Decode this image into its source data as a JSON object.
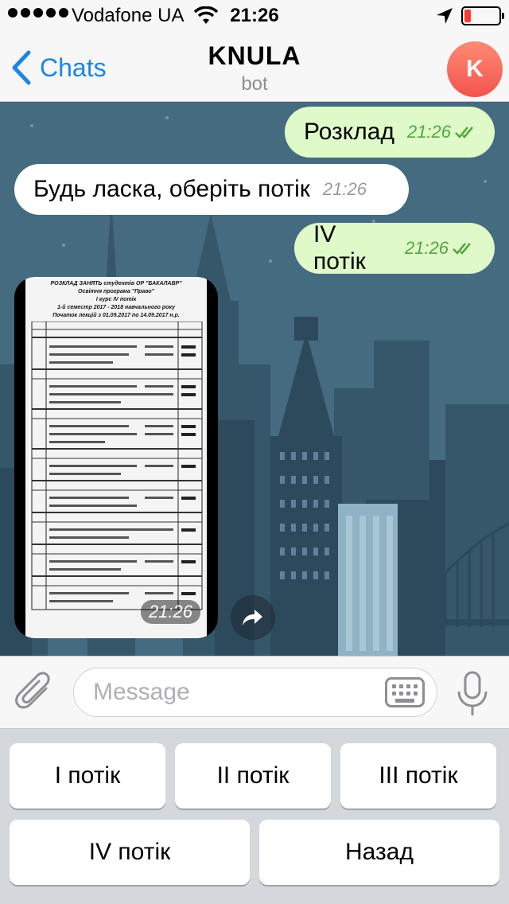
{
  "status_bar": {
    "carrier": "Vodafone UA",
    "time": "21:26",
    "battery_level": 0.1
  },
  "nav": {
    "back_label": "Chats",
    "title": "KNULA",
    "subtitle": "bot",
    "avatar_letter": "K",
    "avatar_color": "#f2544e"
  },
  "messages": [
    {
      "direction": "out",
      "text": "Розклад",
      "time": "21:26",
      "status": "read"
    },
    {
      "direction": "in",
      "text": "Будь ласка, оберіть потік",
      "time": "21:26"
    },
    {
      "direction": "out",
      "text": "IV потік",
      "time": "21:26",
      "status": "read"
    },
    {
      "direction": "in",
      "type": "photo",
      "time": "21:26",
      "doc_title_lines": [
        "РОЗКЛАД ЗАНЯТЬ студентів ОР \"БАКАЛАВР\"",
        "Освітня програма \"Право\"",
        "I курс IV потік",
        "1-й семестр 2017 - 2018 навчального року",
        "Початок лекцій з 01.09.2017 по 14.09.2017 н.р."
      ]
    }
  ],
  "input": {
    "placeholder": "Message"
  },
  "bot_keyboard": {
    "buttons": [
      "I потік",
      "II потік",
      "III потік",
      "IV потік",
      "Назад"
    ]
  },
  "colors": {
    "accent": "#1b86e8",
    "out_bubble": "#e0f9c9",
    "in_bubble": "#ffffff",
    "chat_background": "#3f6479",
    "read_check": "#4ea83a"
  }
}
